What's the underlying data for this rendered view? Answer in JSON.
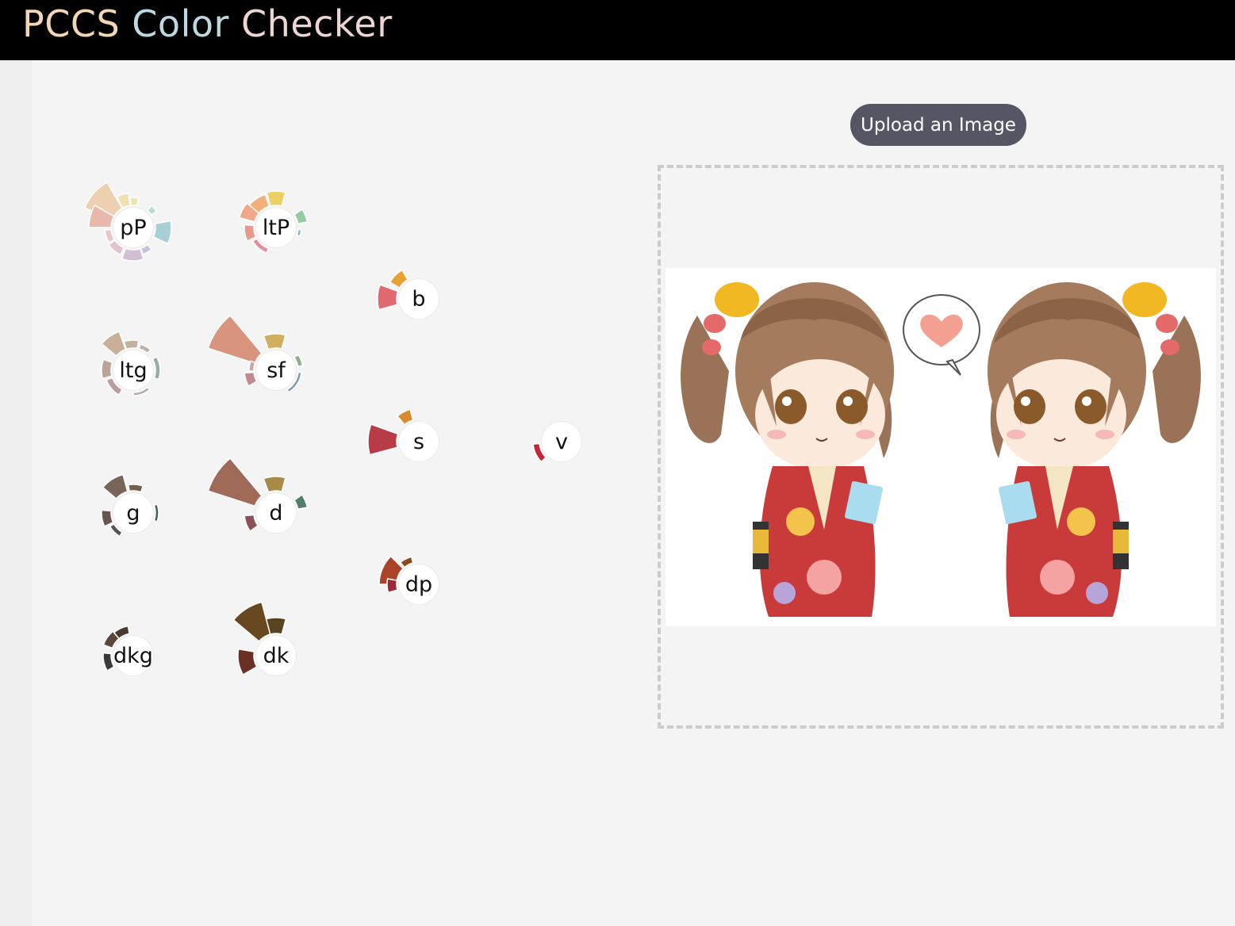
{
  "header": {
    "title_parts": [
      {
        "text": "PCCS",
        "color": "#f1d6b8"
      },
      {
        "text": " Color",
        "color": "#bcd8e0"
      },
      {
        "text": " Checker",
        "color": "#ecd6d4"
      }
    ],
    "background": "#000000"
  },
  "upload": {
    "button_label": "Upload an Image",
    "button_color": "#565564"
  },
  "image": {
    "name": "uploaded-image",
    "description_icon": "kimono-girls-illustration"
  },
  "tones": [
    {
      "id": "pP",
      "label": "pP"
    },
    {
      "id": "ltP",
      "label": "ltP"
    },
    {
      "id": "b",
      "label": "b"
    },
    {
      "id": "ltg",
      "label": "ltg"
    },
    {
      "id": "sf",
      "label": "sf"
    },
    {
      "id": "s",
      "label": "s"
    },
    {
      "id": "v",
      "label": "v"
    },
    {
      "id": "g",
      "label": "g"
    },
    {
      "id": "d",
      "label": "d"
    },
    {
      "id": "dp",
      "label": "dp"
    },
    {
      "id": "dkg",
      "label": "dkg"
    },
    {
      "id": "dk",
      "label": "dk"
    }
  ]
}
